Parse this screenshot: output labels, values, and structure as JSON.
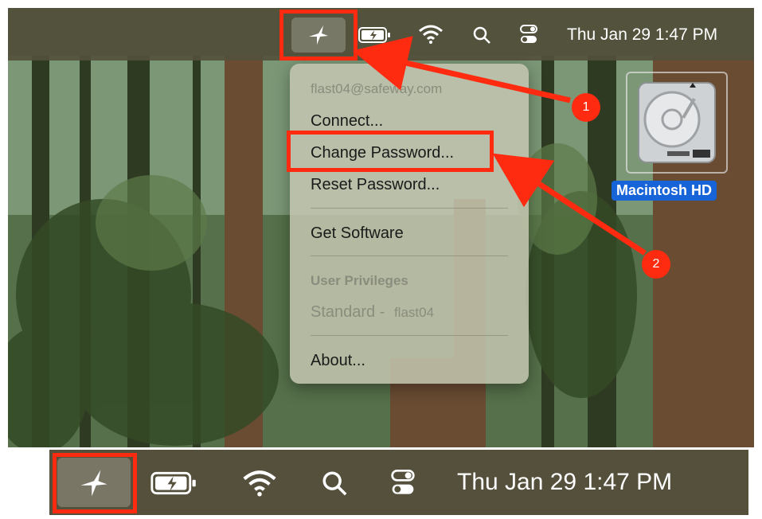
{
  "menubar": {
    "clock": "Thu Jan 29  1:47 PM",
    "icons": [
      "app-star-icon",
      "battery-charging-icon",
      "wifi-icon",
      "search-icon",
      "control-center-icon"
    ]
  },
  "menu": {
    "account": "flast04@safeway.com",
    "connect": "Connect...",
    "change_password": "Change Password...",
    "reset_password": "Reset Password...",
    "get_software": "Get Software",
    "user_privileges_header": "User Privileges",
    "standard_prefix": "Standard - ",
    "standard_user": "flast04",
    "about": "About..."
  },
  "desktop": {
    "drive_label": "Macintosh HD"
  },
  "annotations": {
    "step1": "1",
    "step2": "2",
    "color": "#ff2b10"
  },
  "zoom_bar": {
    "clock": "Thu Jan 29  1:47 PM"
  }
}
